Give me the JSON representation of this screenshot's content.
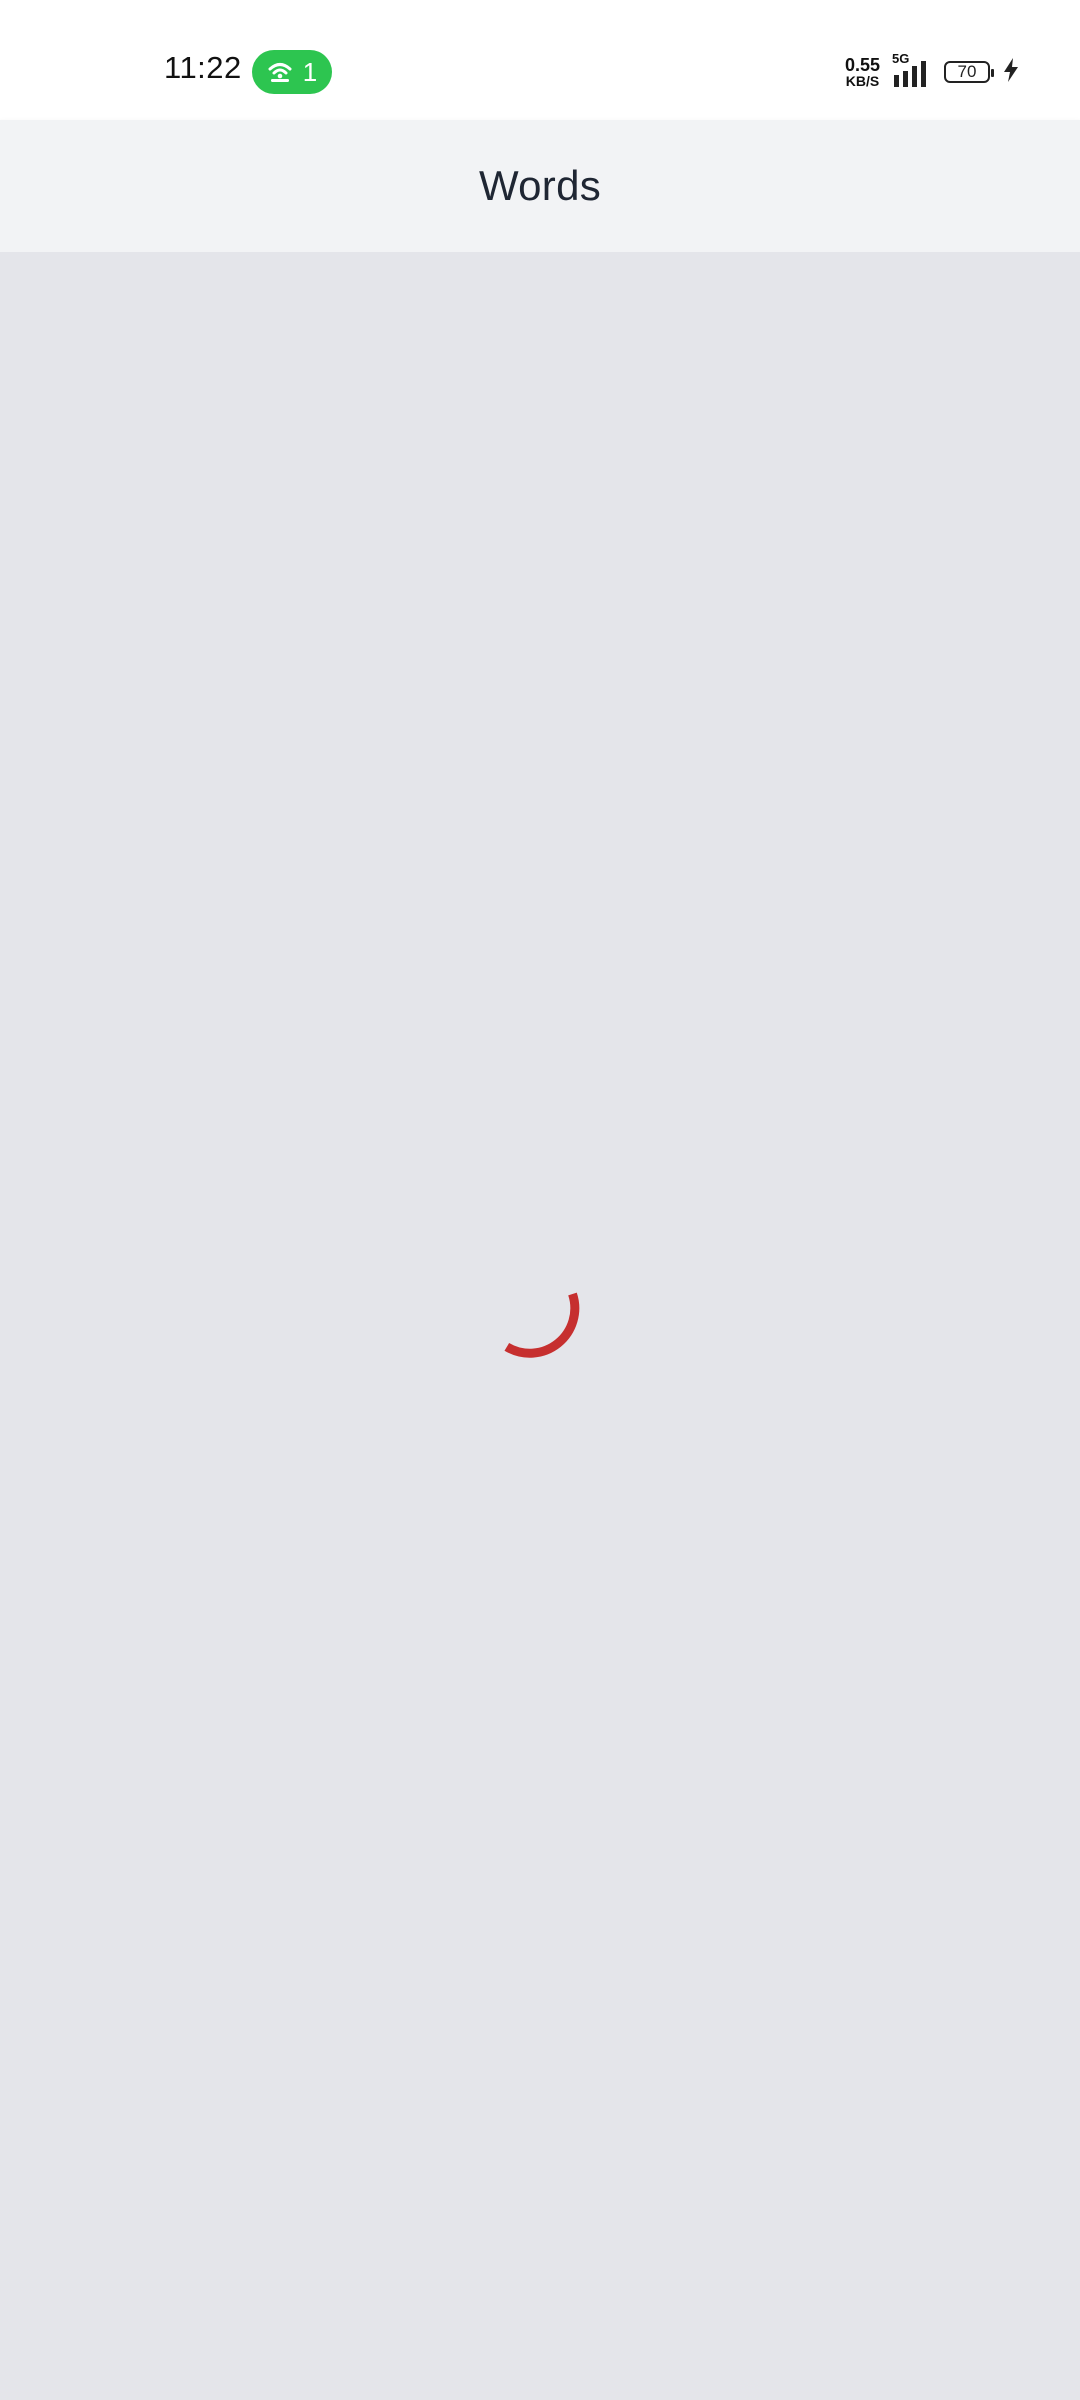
{
  "status_bar": {
    "time": "11:22",
    "hotspot_count": "1",
    "net_speed_value": "0.55",
    "net_speed_unit": "KB/S",
    "network_type": "5G",
    "battery_level": "70",
    "hotspot_color": "#2dc550"
  },
  "app_bar": {
    "title": "Words"
  },
  "loader": {
    "color": "#c62f2f",
    "icon": "loading-spinner-icon"
  }
}
